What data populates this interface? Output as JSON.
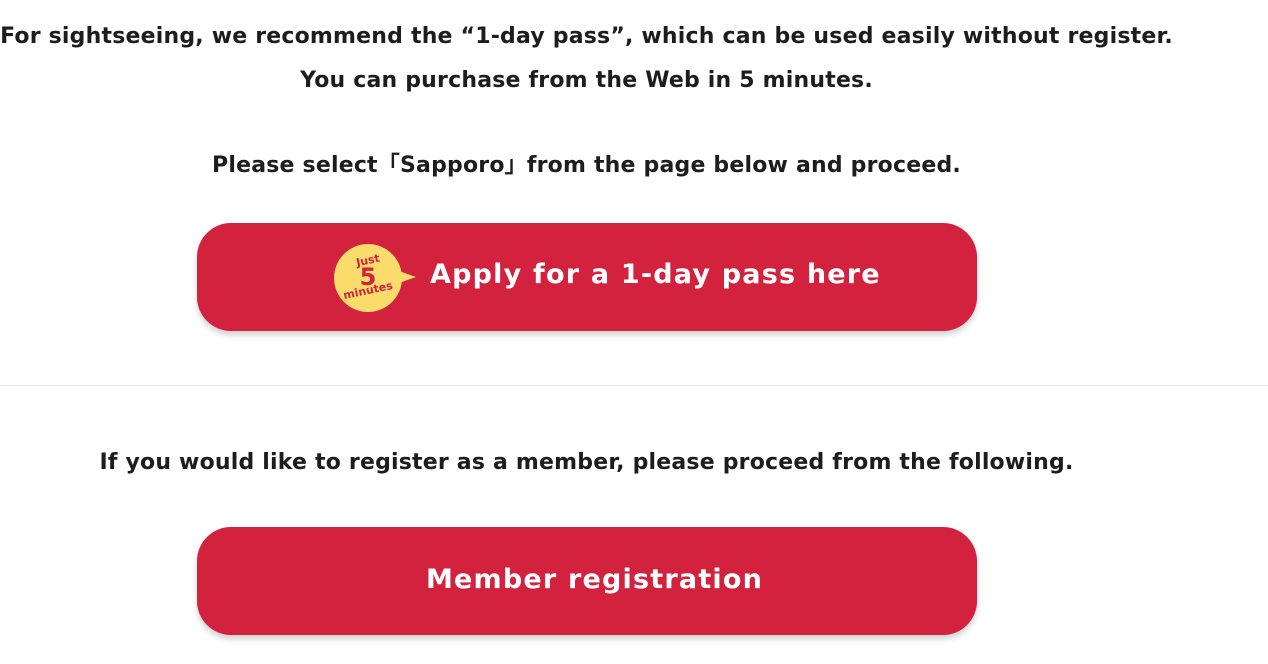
{
  "intro": {
    "line1": "For sightseeing, we recommend the “1-day pass”, which can be used easily without register.",
    "line2": "You can purchase from the Web in 5 minutes.",
    "line3": "Please select「Sapporo」from the page below and proceed."
  },
  "apply_button": {
    "label": "Apply for a 1-day pass here",
    "badge": {
      "top": "Just",
      "number": "5",
      "bottom": "minutes"
    }
  },
  "member": {
    "text": "If you would like to register as a member, please proceed from the following.",
    "button_label": "Member registration"
  },
  "colors": {
    "button": "#d2223d",
    "badge": "#f9dc6b",
    "text": "#1d1d1d"
  }
}
